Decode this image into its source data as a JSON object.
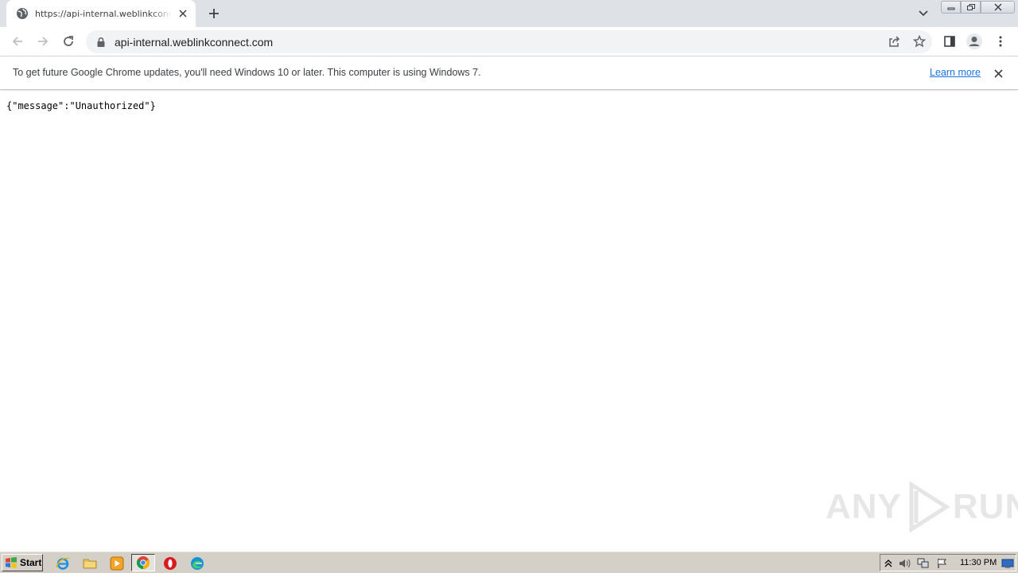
{
  "browser": {
    "tab": {
      "title": "https://api-internal.weblinkconnect.com"
    },
    "address_bar": {
      "url": "api-internal.weblinkconnect.com"
    }
  },
  "infobar": {
    "message": "To get future Google Chrome updates, you'll need Windows 10 or later. This computer is using Windows 7.",
    "link_label": "Learn more"
  },
  "page": {
    "body_text": "{\"message\":\"Unauthorized\"}"
  },
  "watermark": {
    "left": "ANY",
    "right": "RUN"
  },
  "taskbar": {
    "start_label": "Start",
    "pinned": [
      "internet-explorer-icon",
      "folder-icon",
      "media-player-icon",
      "chrome-icon",
      "opera-icon",
      "edge-icon"
    ],
    "clock": "11:30 PM"
  },
  "colors": {
    "tabstrip": "#dee1e6",
    "omnibox": "#f1f3f4",
    "link": "#1a73e8",
    "taskbar": "#d4d0c8"
  }
}
